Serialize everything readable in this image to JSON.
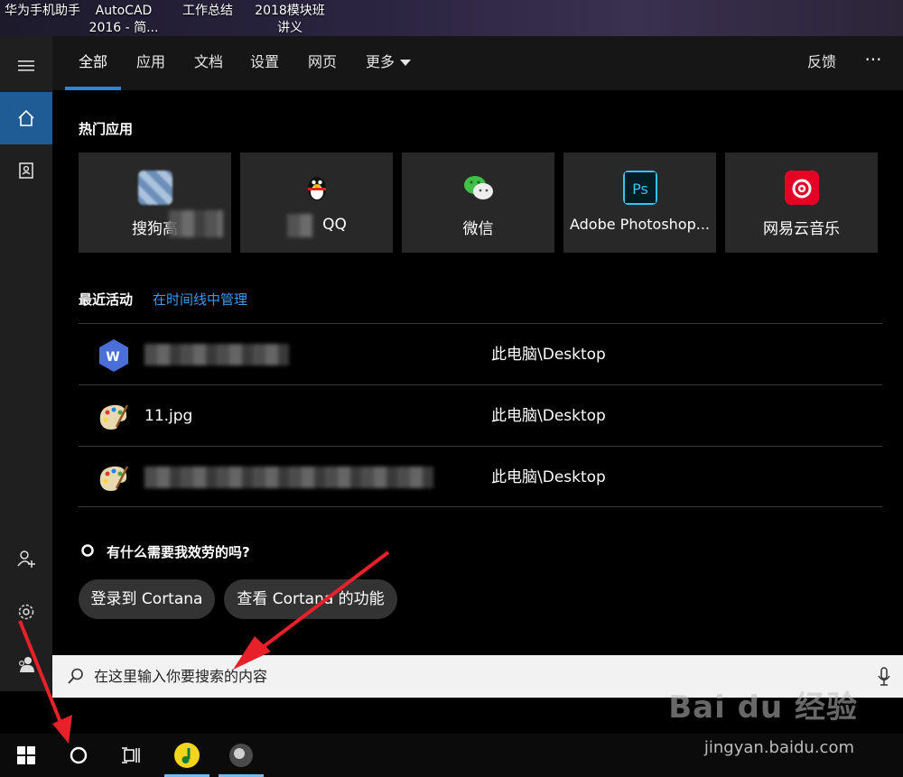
{
  "desktop": {
    "icons": [
      {
        "label": "华为手机助手"
      },
      {
        "label": "AutoCAD\n2016 - 简..."
      },
      {
        "label": "工作总结"
      },
      {
        "label": "2018模块班\n讲义"
      }
    ]
  },
  "sidebar": {
    "items": [
      {
        "icon": "hamburger-menu-icon"
      },
      {
        "icon": "home-icon"
      },
      {
        "icon": "notebook-icon"
      },
      {
        "icon": "add-user-icon"
      },
      {
        "icon": "gear-icon"
      },
      {
        "icon": "account-icon"
      }
    ]
  },
  "tabs": [
    {
      "label": "全部",
      "active": true
    },
    {
      "label": "应用"
    },
    {
      "label": "文档"
    },
    {
      "label": "设置"
    },
    {
      "label": "网页"
    },
    {
      "label": "更多"
    }
  ],
  "header": {
    "feedback": "反馈",
    "more_options": "···"
  },
  "top_apps": {
    "title": "热门应用",
    "apps": [
      {
        "label": "搜狗高"
      },
      {
        "label": "QQ"
      },
      {
        "label": "微信"
      },
      {
        "label": "Adobe Photoshop..."
      },
      {
        "label": "网易云音乐"
      }
    ]
  },
  "recent": {
    "title": "最近活动",
    "manage_link": "在时间线中管理",
    "items": [
      {
        "name": "",
        "path": "此电脑\\Desktop"
      },
      {
        "name": "11.jpg",
        "path": "此电脑\\Desktop"
      },
      {
        "name": "",
        "path": "此电脑\\Desktop"
      }
    ]
  },
  "cortana": {
    "prompt": "有什么需要我效劳的吗?",
    "buttons": [
      {
        "label": "登录到 Cortana"
      },
      {
        "label": "查看 Cortana 的功能"
      }
    ]
  },
  "search": {
    "placeholder": "在这里输入你要搜索的内容"
  },
  "watermark": {
    "brand": "Bai du 经验",
    "url": "jingyan.baidu.com"
  },
  "colors": {
    "accent": "#2f84d7",
    "link": "#3c9ae8",
    "arrow": "#e8202a"
  }
}
